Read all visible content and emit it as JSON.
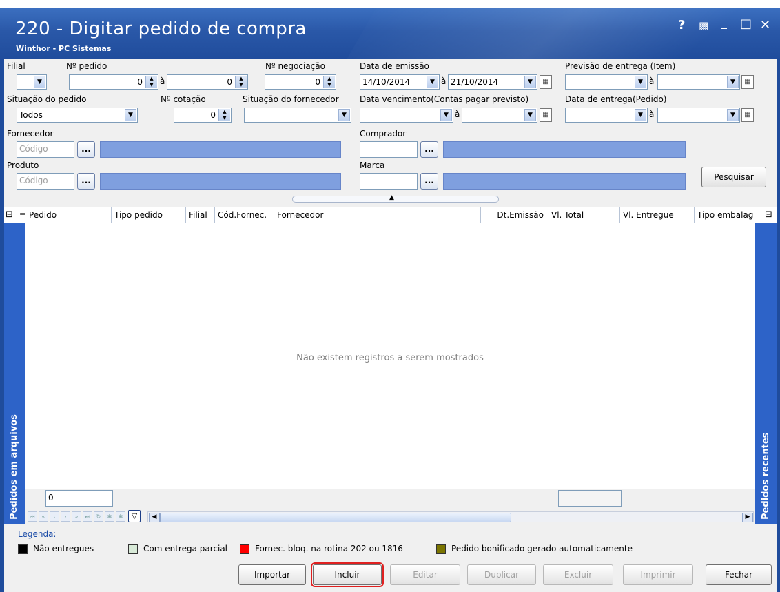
{
  "window": {
    "title": "220 - Digitar pedido de compra",
    "subtitle": "Winthor - PC Sistemas",
    "buttons": {
      "help": "?",
      "restore": "▩",
      "minimize": "_",
      "maximize": "□",
      "close": "✕"
    }
  },
  "filters": {
    "filial_label": "Filial",
    "num_pedido_label": "Nº pedido",
    "num_pedido_from": "0",
    "a1": "à",
    "num_pedido_to": "0",
    "num_negociacao_label": "Nº negociação",
    "num_negociacao": "0",
    "data_emissao_label": "Data de emissão",
    "data_emissao_from": "14/10/2014",
    "a2": "à",
    "data_emissao_to": "21/10/2014",
    "previsao_label": "Previsão  de entrega (Item)",
    "a3": "à",
    "situacao_pedido_label": "Situação do pedido",
    "situacao_pedido": "Todos",
    "num_cotacao_label": "Nº cotação",
    "num_cotacao": "0",
    "situacao_fornecedor_label": "Situação do fornecedor",
    "data_vencimento_label": "Data vencimento(Contas pagar previsto)",
    "a4": "à",
    "data_entrega_label": "Data de entrega(Pedido)",
    "a5": "à",
    "fornecedor_label": "Fornecedor",
    "fornecedor_placeholder": "Código",
    "comprador_label": "Comprador",
    "produto_label": "Produto",
    "produto_placeholder": "Código",
    "marca_label": "Marca",
    "ellipsis": "...",
    "pesquisar": "Pesquisar"
  },
  "grid": {
    "columns": [
      "Pedido",
      "Tipo pedido",
      "Filial",
      "Cód.Fornec.",
      "Fornecedor",
      "Dt.Emissão",
      "Vl. Total",
      "Vl. Entregue",
      "Tipo embalag"
    ],
    "empty_message": "Não existem registros a serem mostrados",
    "count": "0",
    "left_panel": "Pedidos em arquivos",
    "right_panel": "Pedidos recentes"
  },
  "legend": {
    "title": "Legenda:",
    "items": [
      {
        "label": "Não entregues",
        "color": "#000000"
      },
      {
        "label": "Com entrega parcial",
        "color": "#d8ead8"
      },
      {
        "label": "Fornec. bloq. na rotina 202 ou 1816",
        "color": "#ff0000"
      },
      {
        "label": "Pedido bonificado gerado automaticamente",
        "color": "#7a7400"
      }
    ]
  },
  "actions": {
    "importar": "Importar",
    "incluir": "Incluir",
    "editar": "Editar",
    "duplicar": "Duplicar",
    "excluir": "Excluir",
    "imprimir": "Imprimir",
    "fechar": "Fechar"
  },
  "colors": {
    "title_bar": "#2a58a8",
    "side_panel": "#2d63c8",
    "lookup_bar": "#7f9fdf",
    "highlight": "#e02020"
  }
}
